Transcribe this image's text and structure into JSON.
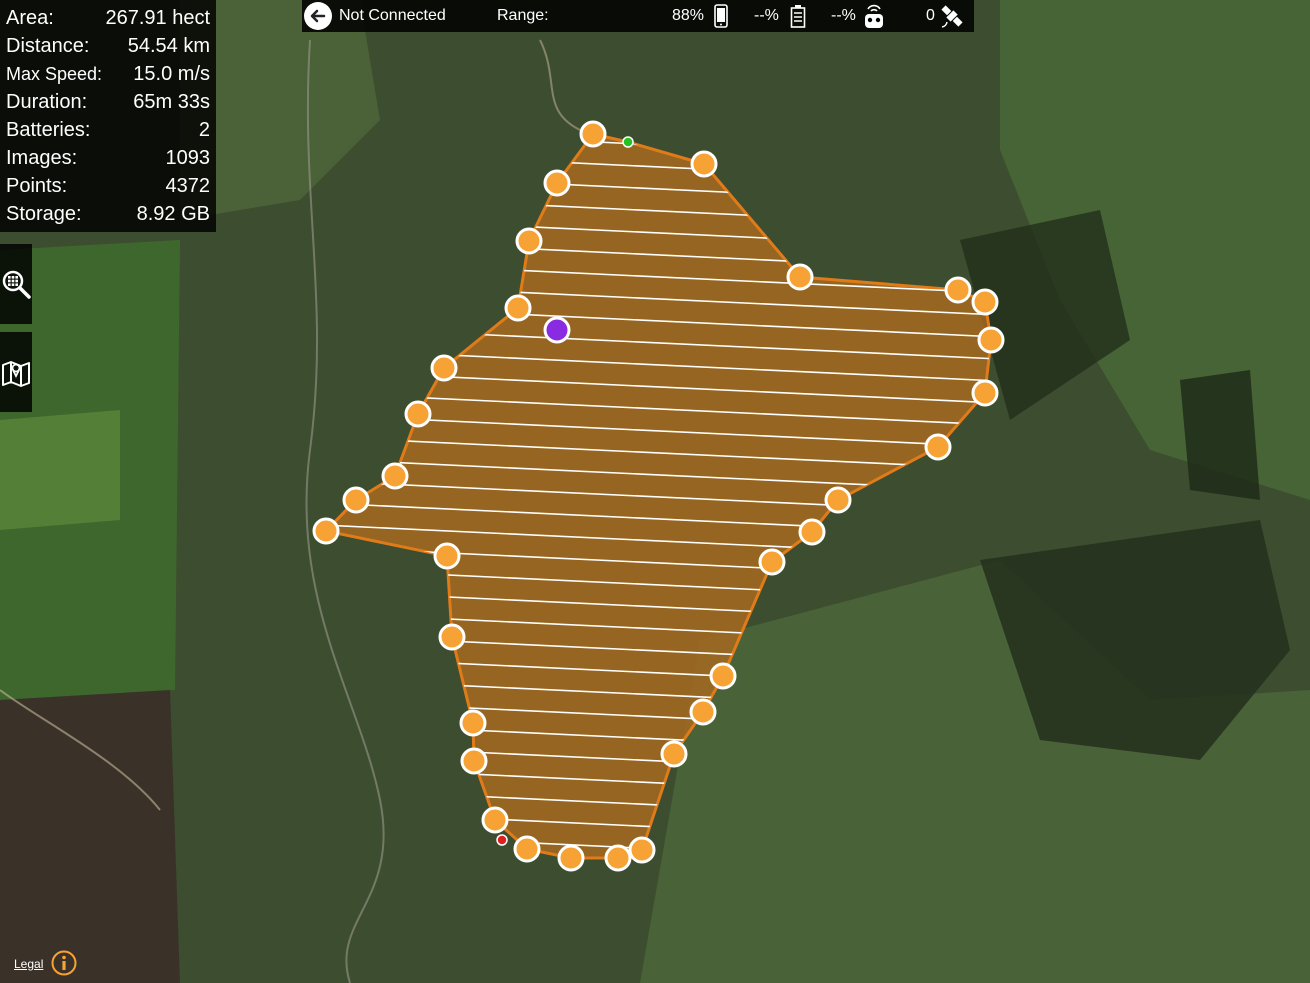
{
  "stats": [
    {
      "label": "Area:",
      "value": "267.91 hect"
    },
    {
      "label": "Distance:",
      "value": "54.54 km"
    },
    {
      "label": "Max Speed:",
      "value": "15.0 m/s"
    },
    {
      "label": "Duration:",
      "value": "65m 33s"
    },
    {
      "label": "Batteries:",
      "value": "2"
    },
    {
      "label": "Images:",
      "value": "1093"
    },
    {
      "label": "Points:",
      "value": "4372"
    },
    {
      "label": "Storage:",
      "value": "8.92 GB"
    }
  ],
  "topbar": {
    "connection": "Not Connected",
    "range_label": "Range:",
    "device_battery": "88%",
    "drone_battery": "--%",
    "controller_signal": "--%",
    "satellites": "0"
  },
  "tools": {
    "search_icon": "grid-search-icon",
    "map_icon": "map-icon"
  },
  "footer": {
    "legal": "Legal",
    "info_icon": "info-icon"
  },
  "colors": {
    "waypoint": "#f7a234",
    "boundary": "#e07b1a",
    "area_fill": "#a86a1e",
    "home_marker": "#8a2be2",
    "start_marker": "#22c322",
    "end_marker": "#e02020"
  }
}
